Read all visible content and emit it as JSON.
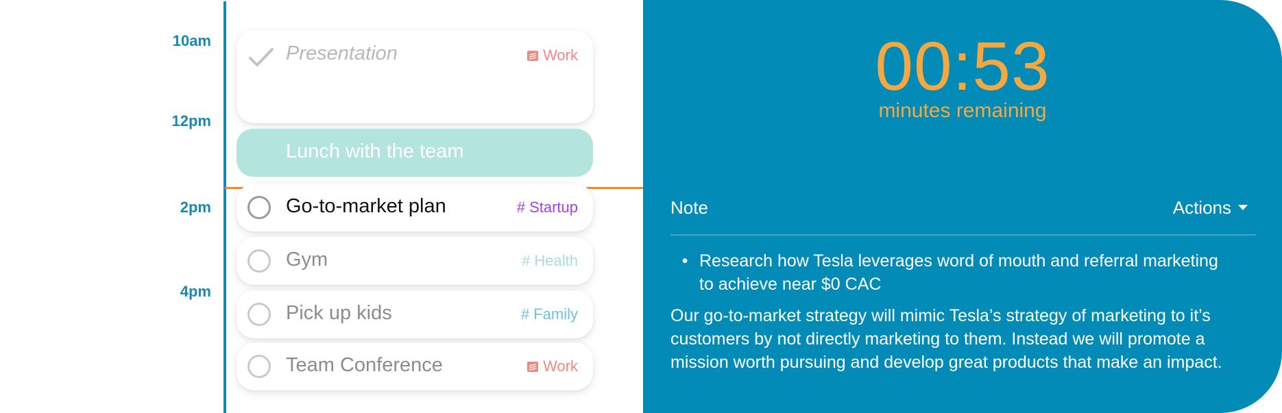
{
  "timeline": {
    "labels": [
      "10am",
      "12pm",
      "2pm",
      "4pm"
    ]
  },
  "tasks": [
    {
      "title": "Presentation",
      "tag": "Work",
      "tag_icon": "calendar-icon",
      "status": "done"
    },
    {
      "title": "Lunch with the team",
      "status": "event"
    },
    {
      "title": "Go-to-market plan",
      "tag": "Startup",
      "tag_icon": "hash-icon",
      "status": "active"
    },
    {
      "title": "Gym",
      "tag": "Health",
      "tag_icon": "hash-icon",
      "status": "pending"
    },
    {
      "title": "Pick up kids",
      "tag": "Family",
      "tag_icon": "hash-icon",
      "status": "pending"
    },
    {
      "title": "Team Conference",
      "tag": "Work",
      "tag_icon": "calendar-icon",
      "status": "pending"
    }
  ],
  "timer": {
    "value": "00:53",
    "label": "minutes remaining"
  },
  "note": {
    "header": "Note",
    "actions_label": "Actions",
    "bullets": [
      "Research how Tesla leverages word of mouth and referral marketing to achieve near $0 CAC"
    ],
    "paragraph": "Our go-to-market strategy will mimic Tesla’s strategy of marketing to it’s customers by not directly marketing to them. Instead we will promote a mission worth pursuing and develop great products that make an impact."
  },
  "colors": {
    "accent": "#1688b4",
    "panel": "#038bb7",
    "timer": "#f4a83f",
    "now_line": "#f28a2c",
    "work": "#ee8a80",
    "startup": "#a043ec",
    "health": "#a9ddd6",
    "family": "#6fc4d6",
    "lunch": "#b3e4de"
  }
}
